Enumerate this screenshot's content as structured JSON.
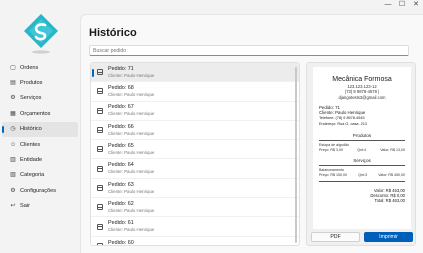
{
  "window": {
    "controls": {
      "minimize": "—",
      "maximize": "☐",
      "close": "✕"
    }
  },
  "sidebar": {
    "items": [
      {
        "label": "Ordens",
        "icon": "orders-icon",
        "glyph": "▢"
      },
      {
        "label": "Produtos",
        "icon": "products-icon",
        "glyph": "▤"
      },
      {
        "label": "Serviços",
        "icon": "services-icon",
        "glyph": "⚙"
      },
      {
        "label": "Orçamentos",
        "icon": "quotes-icon",
        "glyph": "▦"
      },
      {
        "label": "Histórico",
        "icon": "history-icon",
        "glyph": "◷",
        "active": true
      },
      {
        "label": "Clientes",
        "icon": "clients-icon",
        "glyph": "☺"
      },
      {
        "label": "Entidade",
        "icon": "entity-icon",
        "glyph": "▥"
      },
      {
        "label": "Categoria",
        "icon": "category-icon",
        "glyph": "▧"
      },
      {
        "label": "Configurações",
        "icon": "settings-icon",
        "glyph": "⚙"
      },
      {
        "label": "Sair",
        "icon": "logout-icon",
        "glyph": "↩"
      }
    ]
  },
  "main": {
    "title": "Histórico",
    "search_placeholder": "Buscar pedido"
  },
  "orders": [
    {
      "title": "Pedido: 71",
      "client": "Cliente: Paulo Henrique"
    },
    {
      "title": "Pedido: 68",
      "client": "Cliente: Paulo Henrique"
    },
    {
      "title": "Pedido: 67",
      "client": "Cliente: Paulo Henrique"
    },
    {
      "title": "Pedido: 66",
      "client": "Cliente: Paulo Henrique"
    },
    {
      "title": "Pedido: 65",
      "client": "Cliente: Paulo Henrique"
    },
    {
      "title": "Pedido: 64",
      "client": "Cliente: Paulo Henrique"
    },
    {
      "title": "Pedido: 63",
      "client": "Cliente: Paulo Henrique"
    },
    {
      "title": "Pedido: 62",
      "client": "Cliente: Paulo Henrique"
    },
    {
      "title": "Pedido: 61",
      "client": "Cliente: Paulo Henrique"
    },
    {
      "title": "Pedido: 60",
      "client": "Cliente: Paulo Henrique"
    }
  ],
  "receipt": {
    "shop_name": "Mecânica Formosa",
    "doc": "123.123.123-12",
    "phone": "(73) 9 9878-4578 |",
    "email": "djangotests3@gmail.com",
    "order": "Pedido: 71",
    "client": "Cliente: Paulo Henrique",
    "client_phone": "Telefone: (78) 9 8978-4545",
    "client_address": "Endereço: Rua G, casa. 213",
    "products_header": "Produtos",
    "product_name": "Estopa de algodão",
    "product_price": "Preço: R$ 3,00",
    "product_qty": "Qnt:4",
    "product_total": "Valor: R$ 13,00",
    "services_header": "Serviços",
    "service_name": "Balanceamento",
    "service_price": "Preço: R$ 150,00",
    "service_qty": "Qnt:3",
    "service_total": "Valor: R$ 450,00",
    "sum_value": "Valor: R$ 463,00",
    "sum_discount": "Desconto: R$ 0,00",
    "sum_total": "Total: R$ 463,00"
  },
  "actions": {
    "pdf": "PDF",
    "print": "Imprimir"
  },
  "colors": {
    "accent": "#005fb8",
    "logo_teal": "#2bb5c9"
  }
}
